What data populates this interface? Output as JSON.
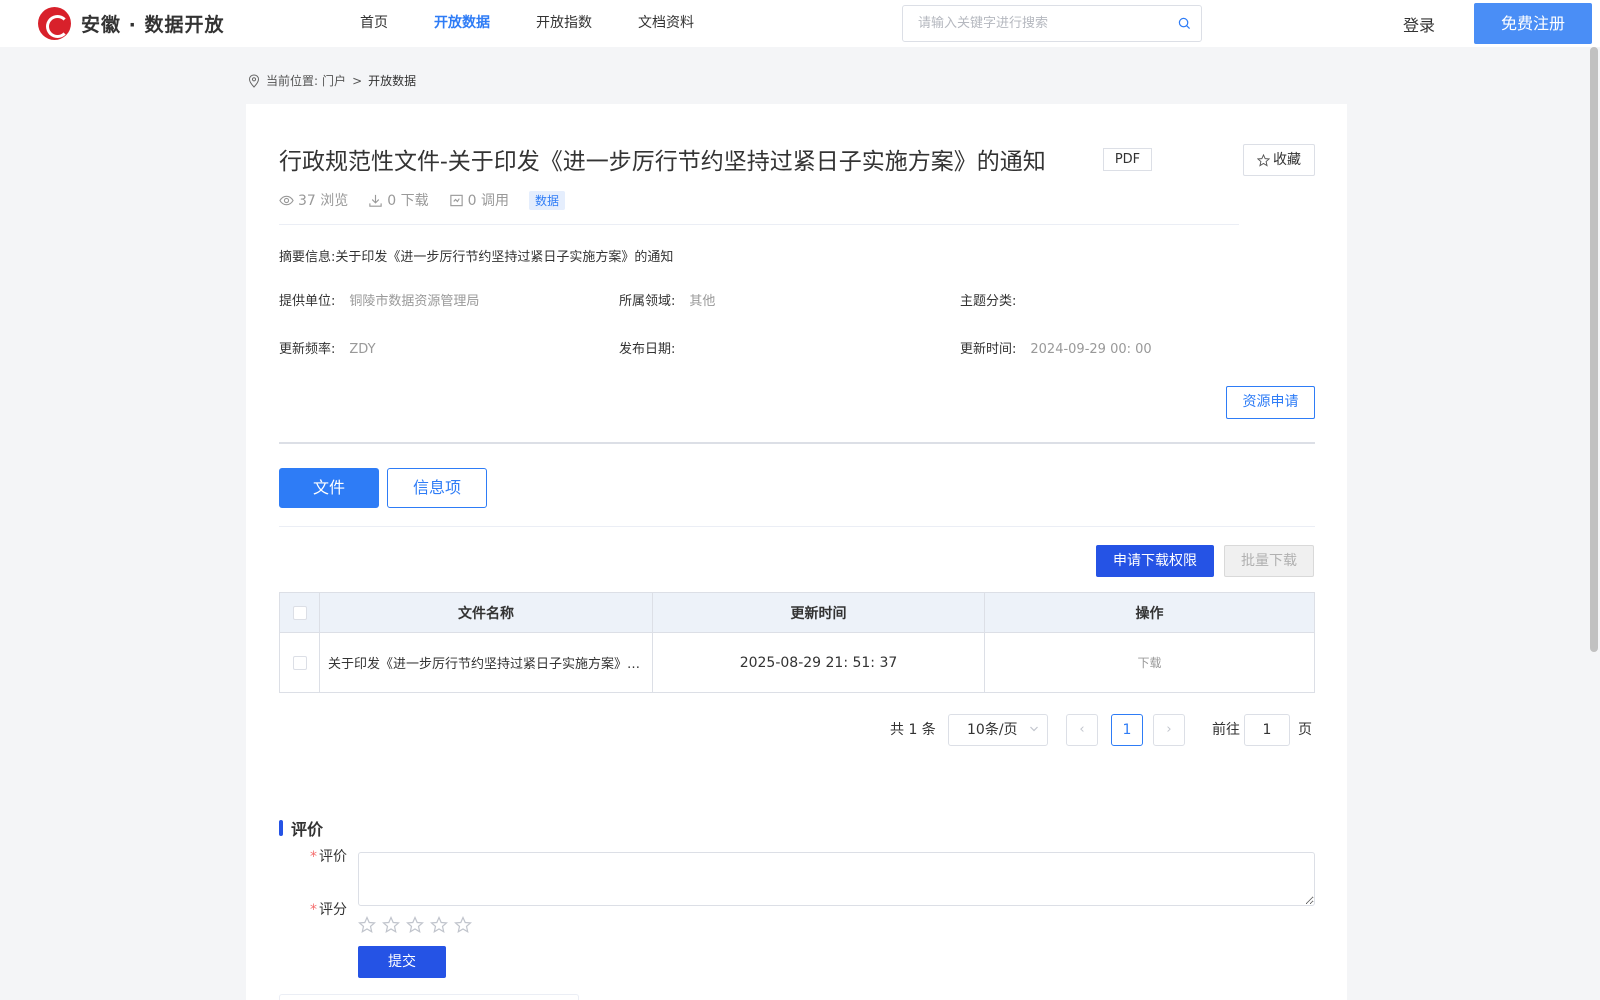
{
  "header": {
    "logo_text": "安徽 · 数据开放",
    "nav": [
      {
        "label": "首页",
        "active": false
      },
      {
        "label": "开放数据",
        "active": true
      },
      {
        "label": "开放指数",
        "active": false
      },
      {
        "label": "文档资料",
        "active": false
      }
    ],
    "search_placeholder": "请输入关键字进行搜索",
    "login_label": "登录",
    "register_label": "免费注册"
  },
  "breadcrumb": {
    "prefix": "当前位置:",
    "home": "门户",
    "separator": ">",
    "current": "开放数据"
  },
  "detail": {
    "title": "行政规范性文件-关于印发《进一步厉行节约坚持过紧日子实施方案》的通知",
    "format_tag": "PDF",
    "favorite_label": "收藏",
    "views": "37 浏览",
    "downloads": "0 下载",
    "calls": "0 调用",
    "type_tag": "数据",
    "summary": "摘要信息:关于印发《进一步厉行节约坚持过紧日子实施方案》的通知",
    "provider_label": "提供单位:",
    "provider_value": "铜陵市数据资源管理局",
    "domain_label": "所属领域:",
    "domain_value": "其他",
    "theme_label": "主题分类:",
    "theme_value": "",
    "freq_label": "更新频率:",
    "freq_value": "ZDY",
    "publish_label": "发布日期:",
    "publish_value": "",
    "update_label": "更新时间:",
    "update_value": "2024-09-29 00: 00",
    "apply_label": "资源申请"
  },
  "tabs": [
    {
      "label": "文件",
      "active": true
    },
    {
      "label": "信息项",
      "active": false
    }
  ],
  "actions": {
    "request_download": "申请下载权限",
    "batch_download": "批量下载"
  },
  "table": {
    "headers": [
      "文件名称",
      "更新时间",
      "操作"
    ],
    "rows": [
      {
        "name": "关于印发《进一步厉行节约坚持过紧日子实施方案》的通知",
        "updated": "2025-08-29 21: 51: 37",
        "op": "下载"
      }
    ]
  },
  "pagination": {
    "total": "共 1 条",
    "page_size": "10条/页",
    "prev": "‹",
    "current_page": "1",
    "next": "›",
    "goto_label": "前往",
    "goto_value": "1",
    "page_suffix": "页"
  },
  "review": {
    "section_title": "评价",
    "comment_label": "评价",
    "rating_label": "评分",
    "required_mark": "*",
    "rating_value": 0,
    "max_rating": 5,
    "submit_label": "提交"
  },
  "colors": {
    "accent": "#2e7cf6",
    "primary_button": "#2553e5",
    "brand_red": "#d8212b"
  }
}
